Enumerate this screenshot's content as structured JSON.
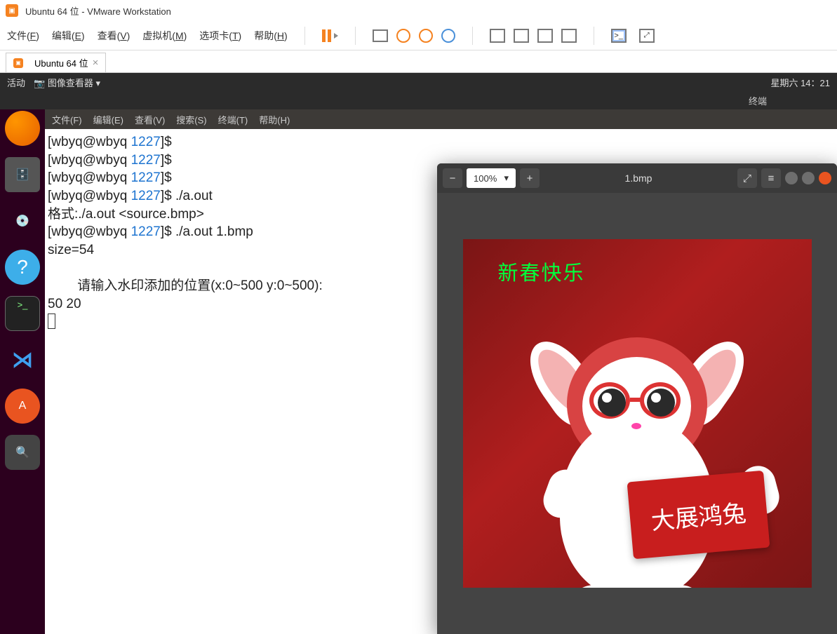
{
  "vmware": {
    "title": "Ubuntu 64 位 - VMware Workstation",
    "menu": {
      "file": "文件",
      "file_key": "F",
      "edit": "编辑",
      "edit_key": "E",
      "view": "查看",
      "view_key": "V",
      "vm": "虚拟机",
      "vm_key": "M",
      "tabs": "选项卡",
      "tabs_key": "T",
      "help": "帮助",
      "help_key": "H"
    },
    "tab_name": "Ubuntu 64 位"
  },
  "ubuntu_topbar": {
    "activities": "活动",
    "app_name": "图像查看器",
    "datetime": "星期六 14：21",
    "subtitle": "终端"
  },
  "terminal": {
    "menu": {
      "file": "文件(F)",
      "edit": "编辑(E)",
      "view": "查看(V)",
      "search": "搜索(S)",
      "terminal": "终端(T)",
      "help": "帮助(H)"
    },
    "prompt_user": "[wbyq@wbyq ",
    "prompt_dir": "1227",
    "prompt_end": "]$ ",
    "cmd1": "./a.out",
    "out1": "格式:./a.out <source.bmp>",
    "cmd2": "./a.out 1.bmp",
    "out2": "size=54",
    "out3": "        请输入水印添加的位置(x:0~500 y:0~500):",
    "input": "50 20"
  },
  "image_viewer": {
    "zoom": "100%",
    "filename": "1.bmp",
    "watermark_text": "新春快乐",
    "sign_text": "大展鸿兔"
  }
}
